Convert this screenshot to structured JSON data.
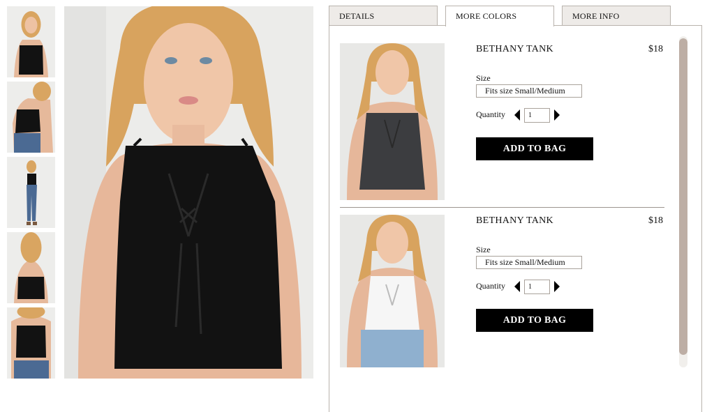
{
  "tabs": [
    {
      "label": "DETAILS"
    },
    {
      "label": "MORE COLORS"
    },
    {
      "label": "MORE INFO"
    }
  ],
  "active_tab": "MORE COLORS",
  "products": [
    {
      "name": "BETHANY TANK",
      "price": "$18",
      "size_label": "Size",
      "size_value": "Fits size Small/Medium",
      "quantity_label": "Quantity",
      "quantity": "1",
      "button_label": "ADD TO BAG",
      "color": "#3c3d40"
    },
    {
      "name": "BETHANY TANK",
      "price": "$18",
      "size_label": "Size",
      "size_value": "Fits size Small/Medium",
      "quantity_label": "Quantity",
      "quantity": "1",
      "button_label": "ADD TO BAG",
      "color": "#f6f6f6"
    }
  ],
  "colors": {
    "accent_scrollbar": "#bdaea5",
    "button_bg": "#000000",
    "tab_bg": "#eeebe8"
  }
}
